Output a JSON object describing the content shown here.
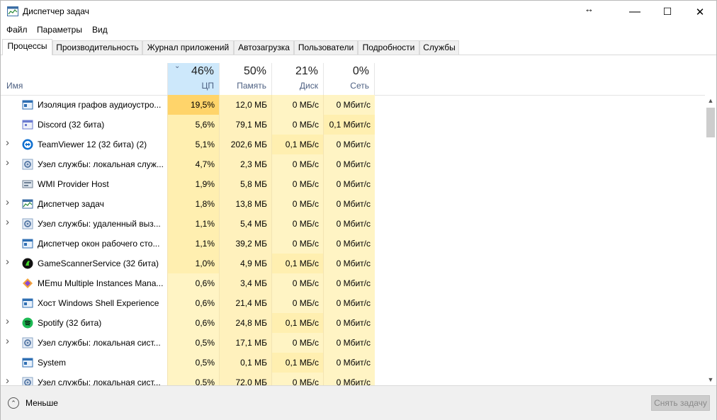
{
  "window": {
    "title": "Диспетчер задач",
    "resize_glyph": "↔",
    "minimize": "—",
    "maximize": "☐",
    "close": "✕"
  },
  "menu": [
    "Файл",
    "Параметры",
    "Вид"
  ],
  "tabs": [
    "Процессы",
    "Производительность",
    "Журнал приложений",
    "Автозагрузка",
    "Пользователи",
    "Подробности",
    "Службы"
  ],
  "active_tab": "Процессы",
  "columns": {
    "name": "Имя",
    "cpu": {
      "pct": "46%",
      "label": "ЦП",
      "sorted": true
    },
    "mem": {
      "pct": "50%",
      "label": "Память"
    },
    "disk": {
      "pct": "21%",
      "label": "Диск"
    },
    "net": {
      "pct": "0%",
      "label": "Сеть"
    }
  },
  "processes": [
    {
      "name": "Изоляция графов аудиоустро...",
      "icon": "window-icon",
      "expand": false,
      "cpu": "19,5%",
      "mem": "12,0 МБ",
      "disk": "0 МБ/с",
      "net": "0 Мбит/с",
      "cpu_heat": 3
    },
    {
      "name": "Discord (32 бита)",
      "icon": "discord-icon",
      "expand": false,
      "cpu": "5,6%",
      "mem": "79,1 МБ",
      "disk": "0 МБ/с",
      "net": "0,1 Мбит/с",
      "cpu_heat": 2
    },
    {
      "name": "TeamViewer 12 (32 бита) (2)",
      "icon": "teamviewer-icon",
      "expand": true,
      "cpu": "5,1%",
      "mem": "202,6 МБ",
      "disk": "0,1 МБ/с",
      "net": "0 Мбит/с",
      "cpu_heat": 2
    },
    {
      "name": "Узел службы: локальная служ...",
      "icon": "gear-icon",
      "expand": true,
      "cpu": "4,7%",
      "mem": "2,3 МБ",
      "disk": "0 МБ/с",
      "net": "0 Мбит/с",
      "cpu_heat": 2
    },
    {
      "name": "WMI Provider Host",
      "icon": "wmi-icon",
      "expand": false,
      "cpu": "1,9%",
      "mem": "5,8 МБ",
      "disk": "0 МБ/с",
      "net": "0 Мбит/с",
      "cpu_heat": 2
    },
    {
      "name": "Диспетчер задач",
      "icon": "task-manager-icon",
      "expand": true,
      "cpu": "1,8%",
      "mem": "13,8 МБ",
      "disk": "0 МБ/с",
      "net": "0 Мбит/с",
      "cpu_heat": 2
    },
    {
      "name": "Узел службы: удаленный выз...",
      "icon": "gear-icon",
      "expand": true,
      "cpu": "1,1%",
      "mem": "5,4 МБ",
      "disk": "0 МБ/с",
      "net": "0 Мбит/с",
      "cpu_heat": 2
    },
    {
      "name": "Диспетчер окон рабочего сто...",
      "icon": "window-icon",
      "expand": false,
      "cpu": "1,1%",
      "mem": "39,2 МБ",
      "disk": "0 МБ/с",
      "net": "0 Мбит/с",
      "cpu_heat": 2
    },
    {
      "name": "GameScannerService (32 бита)",
      "icon": "razer-icon",
      "expand": true,
      "cpu": "1,0%",
      "mem": "4,9 МБ",
      "disk": "0,1 МБ/с",
      "net": "0 Мбит/с",
      "cpu_heat": 2
    },
    {
      "name": "MEmu Multiple Instances Mana...",
      "icon": "memu-icon",
      "expand": false,
      "cpu": "0,6%",
      "mem": "3,4 МБ",
      "disk": "0 МБ/с",
      "net": "0 Мбит/с",
      "cpu_heat": 1
    },
    {
      "name": "Хост Windows Shell Experience",
      "icon": "window-icon",
      "expand": false,
      "cpu": "0,6%",
      "mem": "21,4 МБ",
      "disk": "0 МБ/с",
      "net": "0 Мбит/с",
      "cpu_heat": 1
    },
    {
      "name": "Spotify (32 бита)",
      "icon": "spotify-icon",
      "expand": true,
      "cpu": "0,6%",
      "mem": "24,8 МБ",
      "disk": "0,1 МБ/с",
      "net": "0 Мбит/с",
      "cpu_heat": 1
    },
    {
      "name": "Узел службы: локальная сист...",
      "icon": "gear-icon",
      "expand": true,
      "cpu": "0,5%",
      "mem": "17,1 МБ",
      "disk": "0 МБ/с",
      "net": "0 Мбит/с",
      "cpu_heat": 1
    },
    {
      "name": "System",
      "icon": "window-icon",
      "expand": false,
      "cpu": "0,5%",
      "mem": "0,1 МБ",
      "disk": "0,1 МБ/с",
      "net": "0 Мбит/с",
      "cpu_heat": 1
    },
    {
      "name": "Узел службы: локальная сист...",
      "icon": "gear-icon",
      "expand": true,
      "cpu": "0,5%",
      "mem": "72,0 МБ",
      "disk": "0 МБ/с",
      "net": "0 Мбит/с",
      "cpu_heat": 1
    }
  ],
  "footer": {
    "less_label": "Меньше",
    "end_task_label": "Снять задачу"
  },
  "colors": {
    "heat1": "#fff4c4",
    "heat2": "#ffefb0",
    "heat3": "#ffd46a",
    "cpu_sorted": "#cde8fb"
  }
}
